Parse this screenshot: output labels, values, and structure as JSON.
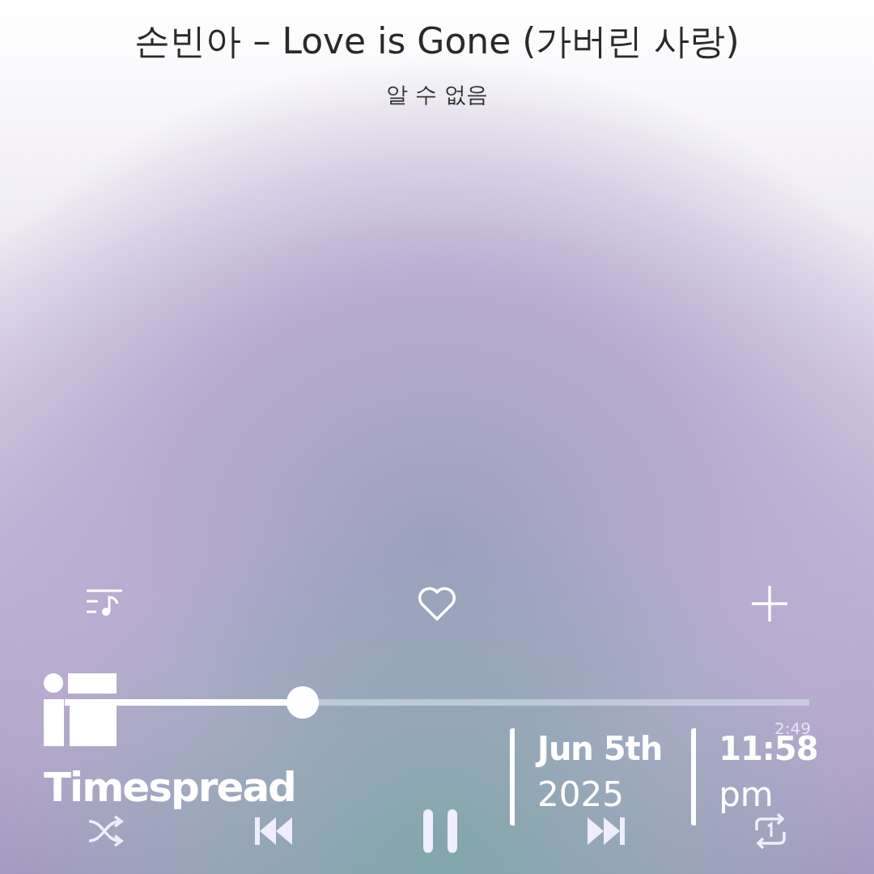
{
  "track": {
    "title": "손빈아 – Love is Gone (가버린 사랑)",
    "artist": "알 수 없음"
  },
  "favorite": false,
  "progress": {
    "level": 0.32,
    "total": "2:49"
  },
  "playing": true,
  "stamp": {
    "brand": "Timespread",
    "date": "Jun 5th",
    "year": "2025",
    "time": "11:58",
    "period": "pm"
  }
}
